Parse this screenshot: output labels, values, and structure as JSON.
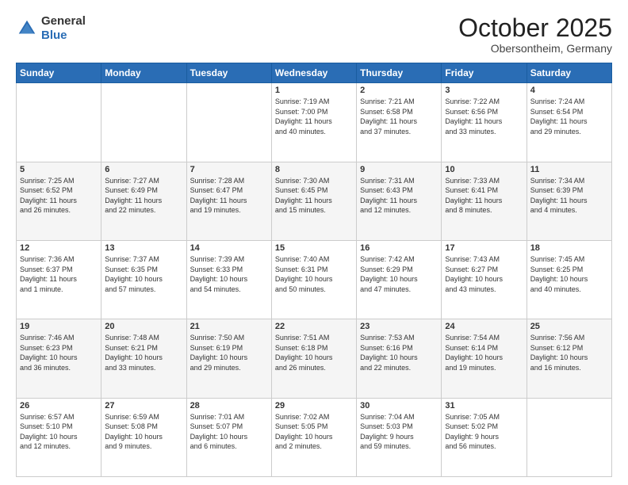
{
  "header": {
    "logo_line1": "General",
    "logo_line2": "Blue",
    "month": "October 2025",
    "location": "Obersontheim, Germany"
  },
  "weekdays": [
    "Sunday",
    "Monday",
    "Tuesday",
    "Wednesday",
    "Thursday",
    "Friday",
    "Saturday"
  ],
  "weeks": [
    [
      {
        "day": "",
        "info": ""
      },
      {
        "day": "",
        "info": ""
      },
      {
        "day": "",
        "info": ""
      },
      {
        "day": "1",
        "info": "Sunrise: 7:19 AM\nSunset: 7:00 PM\nDaylight: 11 hours\nand 40 minutes."
      },
      {
        "day": "2",
        "info": "Sunrise: 7:21 AM\nSunset: 6:58 PM\nDaylight: 11 hours\nand 37 minutes."
      },
      {
        "day": "3",
        "info": "Sunrise: 7:22 AM\nSunset: 6:56 PM\nDaylight: 11 hours\nand 33 minutes."
      },
      {
        "day": "4",
        "info": "Sunrise: 7:24 AM\nSunset: 6:54 PM\nDaylight: 11 hours\nand 29 minutes."
      }
    ],
    [
      {
        "day": "5",
        "info": "Sunrise: 7:25 AM\nSunset: 6:52 PM\nDaylight: 11 hours\nand 26 minutes."
      },
      {
        "day": "6",
        "info": "Sunrise: 7:27 AM\nSunset: 6:49 PM\nDaylight: 11 hours\nand 22 minutes."
      },
      {
        "day": "7",
        "info": "Sunrise: 7:28 AM\nSunset: 6:47 PM\nDaylight: 11 hours\nand 19 minutes."
      },
      {
        "day": "8",
        "info": "Sunrise: 7:30 AM\nSunset: 6:45 PM\nDaylight: 11 hours\nand 15 minutes."
      },
      {
        "day": "9",
        "info": "Sunrise: 7:31 AM\nSunset: 6:43 PM\nDaylight: 11 hours\nand 12 minutes."
      },
      {
        "day": "10",
        "info": "Sunrise: 7:33 AM\nSunset: 6:41 PM\nDaylight: 11 hours\nand 8 minutes."
      },
      {
        "day": "11",
        "info": "Sunrise: 7:34 AM\nSunset: 6:39 PM\nDaylight: 11 hours\nand 4 minutes."
      }
    ],
    [
      {
        "day": "12",
        "info": "Sunrise: 7:36 AM\nSunset: 6:37 PM\nDaylight: 11 hours\nand 1 minute."
      },
      {
        "day": "13",
        "info": "Sunrise: 7:37 AM\nSunset: 6:35 PM\nDaylight: 10 hours\nand 57 minutes."
      },
      {
        "day": "14",
        "info": "Sunrise: 7:39 AM\nSunset: 6:33 PM\nDaylight: 10 hours\nand 54 minutes."
      },
      {
        "day": "15",
        "info": "Sunrise: 7:40 AM\nSunset: 6:31 PM\nDaylight: 10 hours\nand 50 minutes."
      },
      {
        "day": "16",
        "info": "Sunrise: 7:42 AM\nSunset: 6:29 PM\nDaylight: 10 hours\nand 47 minutes."
      },
      {
        "day": "17",
        "info": "Sunrise: 7:43 AM\nSunset: 6:27 PM\nDaylight: 10 hours\nand 43 minutes."
      },
      {
        "day": "18",
        "info": "Sunrise: 7:45 AM\nSunset: 6:25 PM\nDaylight: 10 hours\nand 40 minutes."
      }
    ],
    [
      {
        "day": "19",
        "info": "Sunrise: 7:46 AM\nSunset: 6:23 PM\nDaylight: 10 hours\nand 36 minutes."
      },
      {
        "day": "20",
        "info": "Sunrise: 7:48 AM\nSunset: 6:21 PM\nDaylight: 10 hours\nand 33 minutes."
      },
      {
        "day": "21",
        "info": "Sunrise: 7:50 AM\nSunset: 6:19 PM\nDaylight: 10 hours\nand 29 minutes."
      },
      {
        "day": "22",
        "info": "Sunrise: 7:51 AM\nSunset: 6:18 PM\nDaylight: 10 hours\nand 26 minutes."
      },
      {
        "day": "23",
        "info": "Sunrise: 7:53 AM\nSunset: 6:16 PM\nDaylight: 10 hours\nand 22 minutes."
      },
      {
        "day": "24",
        "info": "Sunrise: 7:54 AM\nSunset: 6:14 PM\nDaylight: 10 hours\nand 19 minutes."
      },
      {
        "day": "25",
        "info": "Sunrise: 7:56 AM\nSunset: 6:12 PM\nDaylight: 10 hours\nand 16 minutes."
      }
    ],
    [
      {
        "day": "26",
        "info": "Sunrise: 6:57 AM\nSunset: 5:10 PM\nDaylight: 10 hours\nand 12 minutes."
      },
      {
        "day": "27",
        "info": "Sunrise: 6:59 AM\nSunset: 5:08 PM\nDaylight: 10 hours\nand 9 minutes."
      },
      {
        "day": "28",
        "info": "Sunrise: 7:01 AM\nSunset: 5:07 PM\nDaylight: 10 hours\nand 6 minutes."
      },
      {
        "day": "29",
        "info": "Sunrise: 7:02 AM\nSunset: 5:05 PM\nDaylight: 10 hours\nand 2 minutes."
      },
      {
        "day": "30",
        "info": "Sunrise: 7:04 AM\nSunset: 5:03 PM\nDaylight: 9 hours\nand 59 minutes."
      },
      {
        "day": "31",
        "info": "Sunrise: 7:05 AM\nSunset: 5:02 PM\nDaylight: 9 hours\nand 56 minutes."
      },
      {
        "day": "",
        "info": ""
      }
    ]
  ]
}
